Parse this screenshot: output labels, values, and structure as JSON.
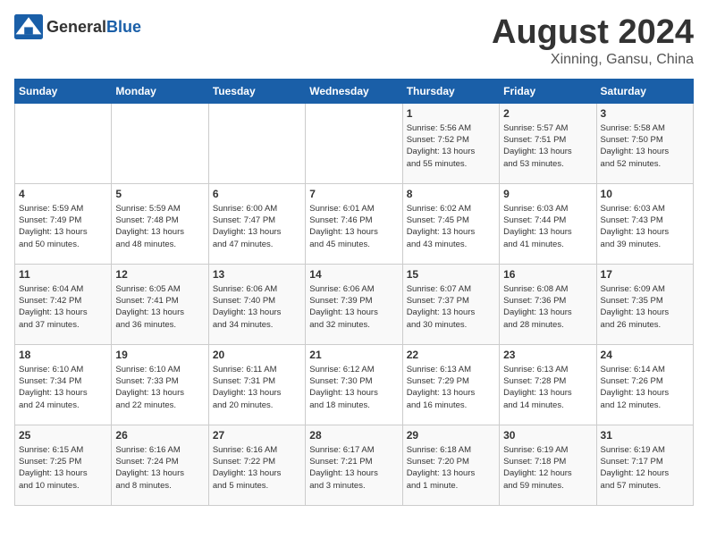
{
  "header": {
    "logo_general": "General",
    "logo_blue": "Blue",
    "month_year": "August 2024",
    "location": "Xinning, Gansu, China"
  },
  "days_of_week": [
    "Sunday",
    "Monday",
    "Tuesday",
    "Wednesday",
    "Thursday",
    "Friday",
    "Saturday"
  ],
  "weeks": [
    [
      {
        "day": "",
        "info": ""
      },
      {
        "day": "",
        "info": ""
      },
      {
        "day": "",
        "info": ""
      },
      {
        "day": "",
        "info": ""
      },
      {
        "day": "1",
        "info": "Sunrise: 5:56 AM\nSunset: 7:52 PM\nDaylight: 13 hours\nand 55 minutes."
      },
      {
        "day": "2",
        "info": "Sunrise: 5:57 AM\nSunset: 7:51 PM\nDaylight: 13 hours\nand 53 minutes."
      },
      {
        "day": "3",
        "info": "Sunrise: 5:58 AM\nSunset: 7:50 PM\nDaylight: 13 hours\nand 52 minutes."
      }
    ],
    [
      {
        "day": "4",
        "info": "Sunrise: 5:59 AM\nSunset: 7:49 PM\nDaylight: 13 hours\nand 50 minutes."
      },
      {
        "day": "5",
        "info": "Sunrise: 5:59 AM\nSunset: 7:48 PM\nDaylight: 13 hours\nand 48 minutes."
      },
      {
        "day": "6",
        "info": "Sunrise: 6:00 AM\nSunset: 7:47 PM\nDaylight: 13 hours\nand 47 minutes."
      },
      {
        "day": "7",
        "info": "Sunrise: 6:01 AM\nSunset: 7:46 PM\nDaylight: 13 hours\nand 45 minutes."
      },
      {
        "day": "8",
        "info": "Sunrise: 6:02 AM\nSunset: 7:45 PM\nDaylight: 13 hours\nand 43 minutes."
      },
      {
        "day": "9",
        "info": "Sunrise: 6:03 AM\nSunset: 7:44 PM\nDaylight: 13 hours\nand 41 minutes."
      },
      {
        "day": "10",
        "info": "Sunrise: 6:03 AM\nSunset: 7:43 PM\nDaylight: 13 hours\nand 39 minutes."
      }
    ],
    [
      {
        "day": "11",
        "info": "Sunrise: 6:04 AM\nSunset: 7:42 PM\nDaylight: 13 hours\nand 37 minutes."
      },
      {
        "day": "12",
        "info": "Sunrise: 6:05 AM\nSunset: 7:41 PM\nDaylight: 13 hours\nand 36 minutes."
      },
      {
        "day": "13",
        "info": "Sunrise: 6:06 AM\nSunset: 7:40 PM\nDaylight: 13 hours\nand 34 minutes."
      },
      {
        "day": "14",
        "info": "Sunrise: 6:06 AM\nSunset: 7:39 PM\nDaylight: 13 hours\nand 32 minutes."
      },
      {
        "day": "15",
        "info": "Sunrise: 6:07 AM\nSunset: 7:37 PM\nDaylight: 13 hours\nand 30 minutes."
      },
      {
        "day": "16",
        "info": "Sunrise: 6:08 AM\nSunset: 7:36 PM\nDaylight: 13 hours\nand 28 minutes."
      },
      {
        "day": "17",
        "info": "Sunrise: 6:09 AM\nSunset: 7:35 PM\nDaylight: 13 hours\nand 26 minutes."
      }
    ],
    [
      {
        "day": "18",
        "info": "Sunrise: 6:10 AM\nSunset: 7:34 PM\nDaylight: 13 hours\nand 24 minutes."
      },
      {
        "day": "19",
        "info": "Sunrise: 6:10 AM\nSunset: 7:33 PM\nDaylight: 13 hours\nand 22 minutes."
      },
      {
        "day": "20",
        "info": "Sunrise: 6:11 AM\nSunset: 7:31 PM\nDaylight: 13 hours\nand 20 minutes."
      },
      {
        "day": "21",
        "info": "Sunrise: 6:12 AM\nSunset: 7:30 PM\nDaylight: 13 hours\nand 18 minutes."
      },
      {
        "day": "22",
        "info": "Sunrise: 6:13 AM\nSunset: 7:29 PM\nDaylight: 13 hours\nand 16 minutes."
      },
      {
        "day": "23",
        "info": "Sunrise: 6:13 AM\nSunset: 7:28 PM\nDaylight: 13 hours\nand 14 minutes."
      },
      {
        "day": "24",
        "info": "Sunrise: 6:14 AM\nSunset: 7:26 PM\nDaylight: 13 hours\nand 12 minutes."
      }
    ],
    [
      {
        "day": "25",
        "info": "Sunrise: 6:15 AM\nSunset: 7:25 PM\nDaylight: 13 hours\nand 10 minutes."
      },
      {
        "day": "26",
        "info": "Sunrise: 6:16 AM\nSunset: 7:24 PM\nDaylight: 13 hours\nand 8 minutes."
      },
      {
        "day": "27",
        "info": "Sunrise: 6:16 AM\nSunset: 7:22 PM\nDaylight: 13 hours\nand 5 minutes."
      },
      {
        "day": "28",
        "info": "Sunrise: 6:17 AM\nSunset: 7:21 PM\nDaylight: 13 hours\nand 3 minutes."
      },
      {
        "day": "29",
        "info": "Sunrise: 6:18 AM\nSunset: 7:20 PM\nDaylight: 13 hours\nand 1 minute."
      },
      {
        "day": "30",
        "info": "Sunrise: 6:19 AM\nSunset: 7:18 PM\nDaylight: 12 hours\nand 59 minutes."
      },
      {
        "day": "31",
        "info": "Sunrise: 6:19 AM\nSunset: 7:17 PM\nDaylight: 12 hours\nand 57 minutes."
      }
    ]
  ]
}
